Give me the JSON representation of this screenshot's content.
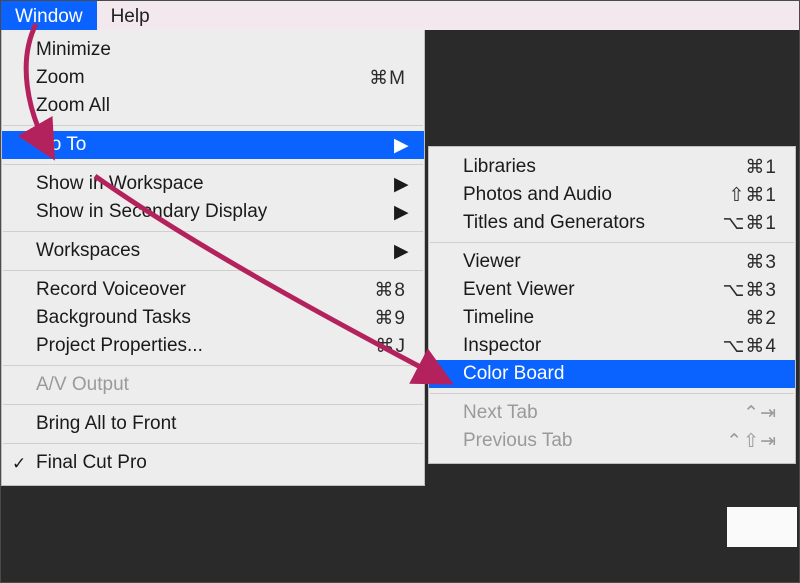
{
  "menubar": {
    "window": "Window",
    "help": "Help"
  },
  "windowMenu": {
    "minimize": "Minimize",
    "zoom": {
      "label": "Zoom",
      "shortcut": "⌘M"
    },
    "zoomAll": "Zoom All",
    "goTo": "Go To",
    "showInWorkspace": "Show in Workspace",
    "showInSecondary": "Show in Secondary Display",
    "workspaces": "Workspaces",
    "recordVoiceover": {
      "label": "Record Voiceover",
      "shortcut": "⌘8"
    },
    "backgroundTasks": {
      "label": "Background Tasks",
      "shortcut": "⌘9"
    },
    "projectProperties": {
      "label": "Project Properties...",
      "shortcut": "⌘J"
    },
    "avOutput": "A/V Output",
    "bringAllToFront": "Bring All to Front",
    "finalCutPro": "Final Cut Pro"
  },
  "goToMenu": {
    "libraries": {
      "label": "Libraries",
      "shortcut": "⌘1"
    },
    "photosAudio": {
      "label": "Photos and Audio",
      "shortcut": "⇧⌘1"
    },
    "titlesGenerators": {
      "label": "Titles and Generators",
      "shortcut": "⌥⌘1"
    },
    "viewer": {
      "label": "Viewer",
      "shortcut": "⌘3"
    },
    "eventViewer": {
      "label": "Event Viewer",
      "shortcut": "⌥⌘3"
    },
    "timeline": {
      "label": "Timeline",
      "shortcut": "⌘2"
    },
    "inspector": {
      "label": "Inspector",
      "shortcut": "⌥⌘4"
    },
    "colorBoard": "Color Board",
    "nextTab": {
      "label": "Next Tab",
      "shortcut": "⌃⇥"
    },
    "previousTab": {
      "label": "Previous Tab",
      "shortcut": "⌃⇧⇥"
    }
  },
  "annotation": {
    "color": "#B4225E"
  }
}
